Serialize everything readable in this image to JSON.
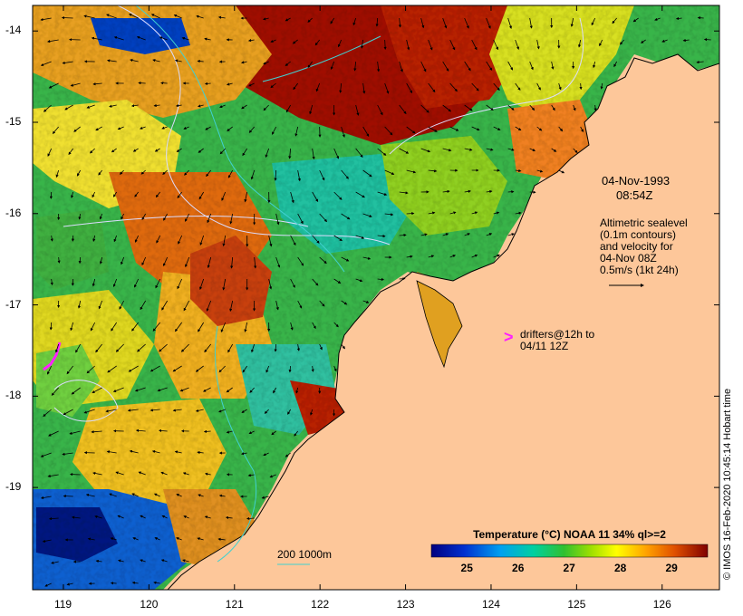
{
  "annotations": {
    "date": "04-Nov-1993",
    "time": "08:54Z",
    "sealevel_lines": [
      "Altimetric sealevel",
      "(0.1m contours)",
      "and velocity for",
      "04-Nov 08Z",
      "0.5m/s (1kt 24h)"
    ],
    "drifter_marker": ">",
    "drifter_lines": [
      "drifters@12h to",
      "04/11 12Z"
    ],
    "isobath_label": "200  1000m",
    "credit": "© IMOS 16-Feb-2020 10:45:14 Hobart time"
  },
  "colorbar": {
    "title": "Temperature (°C) NOAA 11 34% ql>=2",
    "ticks": [
      "25",
      "26",
      "27",
      "28",
      "29"
    ],
    "tick_values": [
      25,
      26,
      27,
      28,
      29
    ],
    "range": [
      24.3,
      29.7
    ]
  },
  "axes": {
    "lon_ticks": [
      "119",
      "120",
      "121",
      "122",
      "123",
      "124",
      "125",
      "126"
    ],
    "lon_values": [
      119,
      120,
      121,
      122,
      123,
      124,
      125,
      126
    ],
    "lat_ticks": [
      "-14",
      "-15",
      "-16",
      "-17",
      "-18",
      "-19"
    ],
    "lat_values": [
      -14,
      -15,
      -16,
      -17,
      -18,
      -19
    ],
    "lon_range": [
      118.64,
      126.67
    ],
    "lat_range": [
      -13.72,
      -20.12
    ]
  },
  "colors": {
    "land": "#fdc79a",
    "coast": "#000000",
    "contour": "#dcdcff",
    "isobath": "#40d0d0",
    "drifter": "#ff20ff",
    "vector": "#000000"
  }
}
